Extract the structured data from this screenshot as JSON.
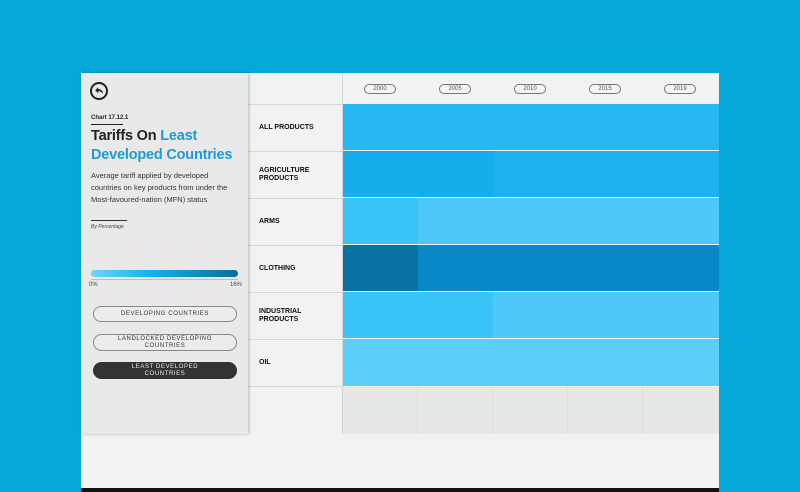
{
  "sidebar": {
    "chart_id": "Chart 17.12.1",
    "title_plain": "Tariffs On ",
    "title_accent": "Least Developed Countries",
    "description": "Average tariff applied by developed countries on key products from under the Most-favoured-nation (MFN) status",
    "unit": "By Percentage",
    "legend_min": "0%",
    "legend_max": "16%",
    "buttons": [
      {
        "label": "DEVELOPING COUNTRIES",
        "active": false
      },
      {
        "label": "LANDLOCKED DEVELOPING COUNTRIES",
        "active": false
      },
      {
        "label": "LEAST DEVELOPED COUNTRIES",
        "active": true
      }
    ]
  },
  "colors": {
    "background": "#04a8d9",
    "accent": "#1e9ad6",
    "scale_low": "#6fd4f7",
    "scale_high": "#0b6d99"
  },
  "chart_data": {
    "type": "heatmap",
    "title": "Tariffs On Least Developed Countries",
    "unit": "%",
    "x": [
      "2000",
      "2005",
      "2010",
      "2015",
      "2019"
    ],
    "value_range": [
      0,
      16
    ],
    "rows": [
      {
        "label": "ALL PRODUCTS",
        "values": [
          5.5,
          5.5,
          5.5,
          5.5,
          5.5
        ]
      },
      {
        "label": "AGRICULTURE PRODUCTS",
        "values": [
          7,
          7,
          6.5,
          6.5,
          6.5
        ]
      },
      {
        "label": "ARMS",
        "values": [
          4,
          2.5,
          2.5,
          2.5,
          2.5
        ]
      },
      {
        "label": "CLOTHING",
        "values": [
          13,
          10.5,
          10.5,
          10.5,
          10.5
        ]
      },
      {
        "label": "INDUSTRIAL PRODUCTS",
        "values": [
          4,
          4,
          2.5,
          2.5,
          2.5
        ]
      },
      {
        "label": "OIL",
        "values": [
          1.5,
          1.5,
          1.5,
          1.5,
          1.5
        ]
      }
    ]
  }
}
